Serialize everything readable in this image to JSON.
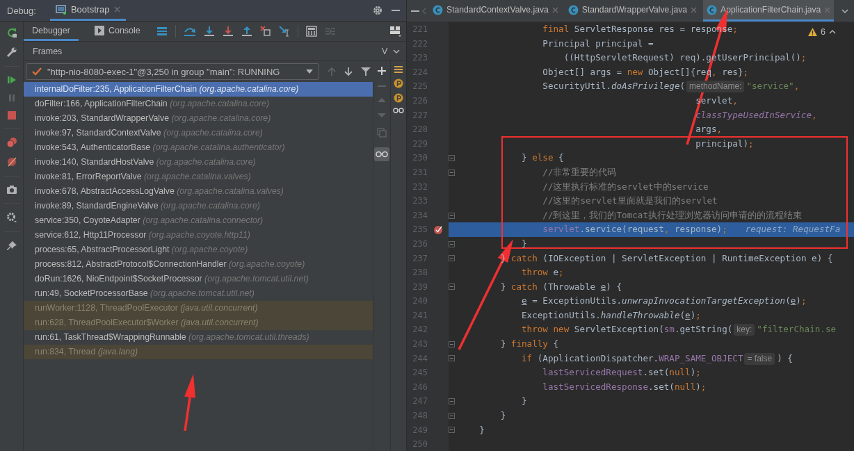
{
  "debug_window": {
    "label": "Debug:",
    "tab": {
      "title": "Bootstrap"
    },
    "view_tabs": [
      {
        "label": "Debugger",
        "selected": true
      },
      {
        "label": "Console",
        "selected": false
      }
    ],
    "frames_header": "Frames",
    "variables_header": "V",
    "thread": {
      "text": "\"http-nio-8080-exec-1\"@3,250 in group \"main\": RUNNING"
    },
    "frames": [
      {
        "method": "internalDoFilter:235, ApplicationFilterChain",
        "package": "(org.apache.catalina.core)",
        "kind": "app",
        "selected": true
      },
      {
        "method": "doFilter:166, ApplicationFilterChain",
        "package": "(org.apache.catalina.core)",
        "kind": "app",
        "selected": false
      },
      {
        "method": "invoke:203, StandardWrapperValve",
        "package": "(org.apache.catalina.core)",
        "kind": "app",
        "selected": false
      },
      {
        "method": "invoke:97, StandardContextValve",
        "package": "(org.apache.catalina.core)",
        "kind": "app",
        "selected": false
      },
      {
        "method": "invoke:543, AuthenticatorBase",
        "package": "(org.apache.catalina.authenticator)",
        "kind": "app",
        "selected": false
      },
      {
        "method": "invoke:140, StandardHostValve",
        "package": "(org.apache.catalina.core)",
        "kind": "app",
        "selected": false
      },
      {
        "method": "invoke:81, ErrorReportValve",
        "package": "(org.apache.catalina.valves)",
        "kind": "app",
        "selected": false
      },
      {
        "method": "invoke:678, AbstractAccessLogValve",
        "package": "(org.apache.catalina.valves)",
        "kind": "app",
        "selected": false
      },
      {
        "method": "invoke:89, StandardEngineValve",
        "package": "(org.apache.catalina.core)",
        "kind": "app",
        "selected": false
      },
      {
        "method": "service:350, CoyoteAdapter",
        "package": "(org.apache.catalina.connector)",
        "kind": "app",
        "selected": false
      },
      {
        "method": "service:612, Http11Processor",
        "package": "(org.apache.coyote.http11)",
        "kind": "app",
        "selected": false
      },
      {
        "method": "process:65, AbstractProcessorLight",
        "package": "(org.apache.coyote)",
        "kind": "app",
        "selected": false
      },
      {
        "method": "process:812, AbstractProtocol$ConnectionHandler",
        "package": "(org.apache.coyote)",
        "kind": "app",
        "selected": false
      },
      {
        "method": "doRun:1626, NioEndpoint$SocketProcessor",
        "package": "(org.apache.tomcat.util.net)",
        "kind": "app",
        "selected": false
      },
      {
        "method": "run:49, SocketProcessorBase",
        "package": "(org.apache.tomcat.util.net)",
        "kind": "app",
        "selected": false
      },
      {
        "method": "runWorker:1128, ThreadPoolExecutor",
        "package": "(java.util.concurrent)",
        "kind": "library",
        "selected": false
      },
      {
        "method": "run:628, ThreadPoolExecutor$Worker",
        "package": "(java.util.concurrent)",
        "kind": "library",
        "selected": false
      },
      {
        "method": "run:61, TaskThread$WrappingRunnable",
        "package": "(org.apache.tomcat.util.threads)",
        "kind": "app",
        "selected": false
      },
      {
        "method": "run:834, Thread",
        "package": "(java.lang)",
        "kind": "library",
        "selected": false
      }
    ]
  },
  "editor": {
    "tabs": [
      {
        "title": "StandardContextValve.java",
        "selected": false
      },
      {
        "title": "StandardWrapperValve.java",
        "selected": false
      },
      {
        "title": "ApplicationFilterChain.java",
        "selected": true
      }
    ],
    "warnings": "6",
    "lines": [
      {
        "no": "221",
        "fold": false,
        "current": false,
        "tokens": [
          {
            "kind": "keyword",
            "text": "                final"
          },
          {
            "kind": "plain",
            "text": " ServletResponse res = response"
          },
          {
            "kind": "punct",
            "text": ";"
          }
        ]
      },
      {
        "no": "222",
        "fold": false,
        "current": false,
        "tokens": [
          {
            "kind": "plain",
            "text": "                Principal principal ="
          }
        ]
      },
      {
        "no": "223",
        "fold": false,
        "current": false,
        "tokens": [
          {
            "kind": "plain",
            "text": "                    ((HttpServletRequest) req).getUserPrincipal()"
          },
          {
            "kind": "punct",
            "text": ";"
          }
        ]
      },
      {
        "no": "224",
        "fold": false,
        "current": false,
        "tokens": [
          {
            "kind": "plain",
            "text": "                Object[] args = "
          },
          {
            "kind": "keyword",
            "text": "new"
          },
          {
            "kind": "plain",
            "text": " Object[]{req"
          },
          {
            "kind": "punct",
            "text": ","
          },
          {
            "kind": "plain",
            "text": " res}"
          },
          {
            "kind": "punct",
            "text": ";"
          }
        ]
      },
      {
        "no": "225",
        "fold": false,
        "current": false,
        "tokens": [
          {
            "kind": "plain",
            "text": "                SecurityUtil."
          },
          {
            "kind": "static",
            "text": "doAsPrivilege"
          },
          {
            "kind": "plain",
            "text": "("
          },
          {
            "kind": "hint",
            "text": "methodName:"
          },
          {
            "kind": "string",
            "text": "\"service\""
          },
          {
            "kind": "punct",
            "text": ","
          }
        ]
      },
      {
        "no": "226",
        "fold": false,
        "current": false,
        "tokens": [
          {
            "kind": "plain",
            "text": "                                             servlet"
          },
          {
            "kind": "punct",
            "text": ","
          }
        ]
      },
      {
        "no": "227",
        "fold": false,
        "current": false,
        "tokens": [
          {
            "kind": "field",
            "text": "                                             classTypeUsedInService"
          },
          {
            "kind": "punct",
            "text": ","
          }
        ]
      },
      {
        "no": "228",
        "fold": false,
        "current": false,
        "tokens": [
          {
            "kind": "plain",
            "text": "                                             args"
          },
          {
            "kind": "punct",
            "text": ","
          }
        ]
      },
      {
        "no": "229",
        "fold": false,
        "current": false,
        "tokens": [
          {
            "kind": "plain",
            "text": "                                             principal)"
          },
          {
            "kind": "punct",
            "text": ";"
          }
        ]
      },
      {
        "no": "230",
        "fold": true,
        "current": false,
        "tokens": [
          {
            "kind": "plain",
            "text": "            } "
          },
          {
            "kind": "keyword",
            "text": "else"
          },
          {
            "kind": "plain",
            "text": " {"
          }
        ]
      },
      {
        "no": "231",
        "fold": true,
        "current": false,
        "tokens": [
          {
            "kind": "comment",
            "text": "                //非常重要的代码"
          }
        ]
      },
      {
        "no": "232",
        "fold": false,
        "current": false,
        "tokens": [
          {
            "kind": "comment",
            "text": "                //这里执行标准的servlet中的service"
          }
        ]
      },
      {
        "no": "233",
        "fold": false,
        "current": false,
        "tokens": [
          {
            "kind": "comment",
            "text": "                //这里的servlet里面就是我们的servlet"
          }
        ]
      },
      {
        "no": "234",
        "fold": true,
        "current": false,
        "tokens": [
          {
            "kind": "comment",
            "text": "                //到这里，我们的Tomcat执行处理浏览器访问申请的的流程结束"
          }
        ]
      },
      {
        "no": "235",
        "fold": false,
        "current": true,
        "breakpoint": true,
        "tokens": [
          {
            "kind": "field",
            "text": "                servlet"
          },
          {
            "kind": "plain",
            "text": ".service(request"
          },
          {
            "kind": "punct",
            "text": ","
          },
          {
            "kind": "plain",
            "text": " response)"
          },
          {
            "kind": "punct",
            "text": ";"
          },
          {
            "kind": "debug",
            "text": "request: RequestFa"
          }
        ]
      },
      {
        "no": "236",
        "fold": true,
        "current": false,
        "tokens": [
          {
            "kind": "plain",
            "text": "            }"
          }
        ]
      },
      {
        "no": "237",
        "fold": true,
        "current": false,
        "tokens": [
          {
            "kind": "plain",
            "text": "        } "
          },
          {
            "kind": "keyword",
            "text": "catch"
          },
          {
            "kind": "plain",
            "text": " (IOException | ServletException | RuntimeException e) {"
          }
        ]
      },
      {
        "no": "238",
        "fold": false,
        "current": false,
        "tokens": [
          {
            "kind": "keyword",
            "text": "            throw"
          },
          {
            "kind": "plain",
            "text": " e"
          },
          {
            "kind": "punct",
            "text": ";"
          }
        ]
      },
      {
        "no": "239",
        "fold": true,
        "current": false,
        "tokens": [
          {
            "kind": "plain",
            "text": "        } "
          },
          {
            "kind": "keyword",
            "text": "catch"
          },
          {
            "kind": "plain",
            "text": " (Throwable "
          },
          {
            "kind": "reassigned",
            "text": "e"
          },
          {
            "kind": "plain",
            "text": ") {"
          }
        ]
      },
      {
        "no": "240",
        "fold": false,
        "current": false,
        "tokens": [
          {
            "kind": "reassigned",
            "text": "            e"
          },
          {
            "kind": "plain",
            "text": " = ExceptionUtils."
          },
          {
            "kind": "static",
            "text": "unwrapInvocationTargetException"
          },
          {
            "kind": "plain",
            "text": "("
          },
          {
            "kind": "reassigned",
            "text": "e"
          },
          {
            "kind": "plain",
            "text": ")"
          },
          {
            "kind": "punct",
            "text": ";"
          }
        ]
      },
      {
        "no": "241",
        "fold": false,
        "current": false,
        "tokens": [
          {
            "kind": "plain",
            "text": "            ExceptionUtils."
          },
          {
            "kind": "static",
            "text": "handleThrowable"
          },
          {
            "kind": "plain",
            "text": "("
          },
          {
            "kind": "reassigned",
            "text": "e"
          },
          {
            "kind": "plain",
            "text": ")"
          },
          {
            "kind": "punct",
            "text": ";"
          }
        ]
      },
      {
        "no": "242",
        "fold": false,
        "current": false,
        "tokens": [
          {
            "kind": "keyword",
            "text": "            throw new"
          },
          {
            "kind": "plain",
            "text": " ServletException("
          },
          {
            "kind": "field",
            "text": "sm"
          },
          {
            "kind": "plain",
            "text": ".getString("
          },
          {
            "kind": "hint",
            "text": "key:"
          },
          {
            "kind": "string",
            "text": "\"filterChain.se"
          }
        ]
      },
      {
        "no": "243",
        "fold": true,
        "current": false,
        "tokens": [
          {
            "kind": "plain",
            "text": "        } "
          },
          {
            "kind": "keyword",
            "text": "finally"
          },
          {
            "kind": "plain",
            "text": " {"
          }
        ]
      },
      {
        "no": "244",
        "fold": true,
        "current": false,
        "tokens": [
          {
            "kind": "keyword",
            "text": "            if"
          },
          {
            "kind": "plain",
            "text": " (ApplicationDispatcher."
          },
          {
            "kind": "field",
            "text": "WRAP_SAME_OBJECT"
          },
          {
            "kind": "hint",
            "text": "= false"
          },
          {
            "kind": "plain",
            "text": ") {"
          }
        ]
      },
      {
        "no": "245",
        "fold": false,
        "current": false,
        "tokens": [
          {
            "kind": "field",
            "text": "                lastServicedRequest"
          },
          {
            "kind": "plain",
            "text": ".set("
          },
          {
            "kind": "keyword",
            "text": "null"
          },
          {
            "kind": "plain",
            "text": ")"
          },
          {
            "kind": "punct",
            "text": ";"
          }
        ]
      },
      {
        "no": "246",
        "fold": false,
        "current": false,
        "tokens": [
          {
            "kind": "field",
            "text": "                lastServicedResponse"
          },
          {
            "kind": "plain",
            "text": ".set("
          },
          {
            "kind": "keyword",
            "text": "null"
          },
          {
            "kind": "plain",
            "text": ")"
          },
          {
            "kind": "punct",
            "text": ";"
          }
        ]
      },
      {
        "no": "247",
        "fold": true,
        "current": false,
        "tokens": [
          {
            "kind": "plain",
            "text": "            }"
          }
        ]
      },
      {
        "no": "248",
        "fold": true,
        "current": false,
        "tokens": [
          {
            "kind": "plain",
            "text": "        }"
          }
        ]
      },
      {
        "no": "249",
        "fold": true,
        "current": false,
        "tokens": [
          {
            "kind": "plain",
            "text": "    }"
          }
        ]
      },
      {
        "no": "250",
        "fold": false,
        "current": false
      }
    ]
  }
}
